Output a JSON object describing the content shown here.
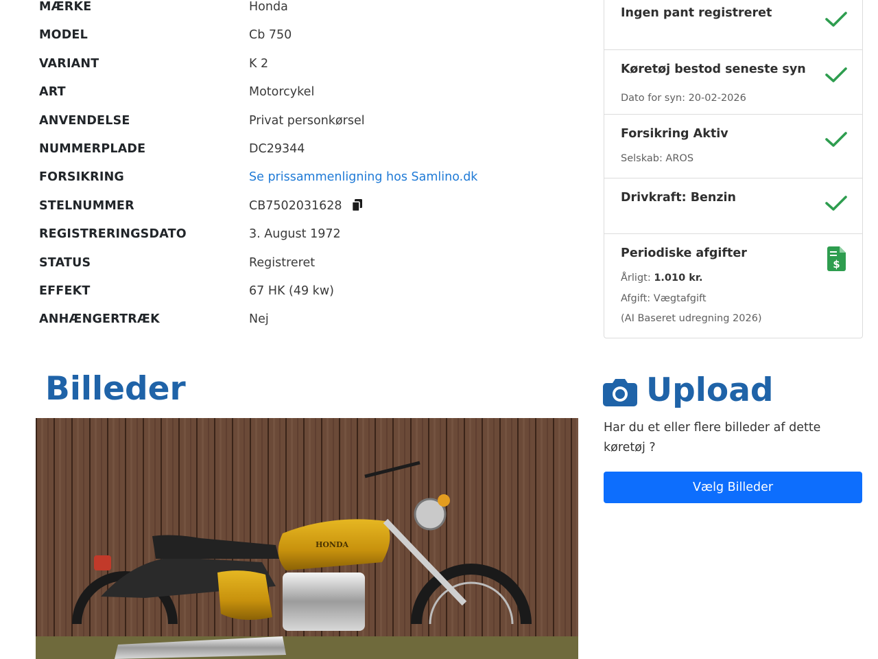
{
  "specs": [
    {
      "key": "MÆRKE",
      "value": "Honda"
    },
    {
      "key": "MODEL",
      "value": "Cb 750"
    },
    {
      "key": "VARIANT",
      "value": "K 2"
    },
    {
      "key": "ART",
      "value": "Motorcykel"
    },
    {
      "key": "ANVENDELSE",
      "value": "Privat personkørsel"
    },
    {
      "key": "NUMMERPLADE",
      "value": "DC29344"
    },
    {
      "key": "FORSIKRING",
      "value": "Se prissammenligning hos Samlino.dk"
    },
    {
      "key": "STELNUMMER",
      "value": "CB7502031628"
    },
    {
      "key": "REGISTRERINGSDATO",
      "value": "3. August 1972"
    },
    {
      "key": "STATUS",
      "value": "Registreret"
    },
    {
      "key": "EFFEKT",
      "value": "67 HK (49 kw)"
    },
    {
      "key": "ANHÆNGERTRÆK",
      "value": "Nej"
    }
  ],
  "status": {
    "pant": {
      "title": "Ingen pant registreret"
    },
    "syn": {
      "title": "Køretøj bestod seneste syn",
      "sub": "Dato for syn: 20-02-2026"
    },
    "forsikring": {
      "title": "Forsikring Aktiv",
      "sub": "Selskab: AROS"
    },
    "drivkraft": {
      "title": "Drivkraft: Benzin"
    },
    "afgifter": {
      "title": "Periodiske afgifter",
      "yearly_label": "Årligt:",
      "yearly_value": "1.010 kr.",
      "type": "Afgift: Vægtafgift",
      "note": "(AI Baseret udregning 2026)"
    }
  },
  "billeder": {
    "title": "Billeder",
    "photo_brand_text": "HONDA"
  },
  "upload": {
    "title": "Upload",
    "text": "Har du et eller flere billeder af dette køretøj ?",
    "button_label": "Vælg Billeder"
  },
  "icons": {
    "check": "check-icon",
    "copy": "copy-icon",
    "money_document": "money-document-icon",
    "camera": "camera-icon"
  },
  "colors": {
    "heading_blue": "#1f63a8",
    "link_blue": "#1f7ad6",
    "button_blue": "#0d6efd",
    "check_green": "#2e9d4f"
  }
}
